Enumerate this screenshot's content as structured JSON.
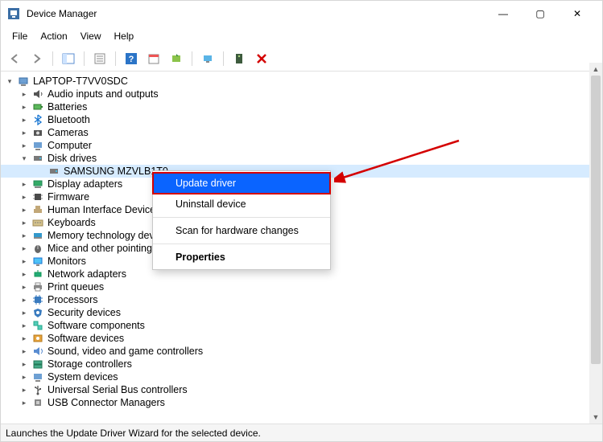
{
  "window": {
    "title": "Device Manager",
    "minimize_glyph": "—",
    "maximize_glyph": "▢",
    "close_glyph": "✕"
  },
  "menu": {
    "file": "File",
    "action": "Action",
    "view": "View",
    "help": "Help"
  },
  "tree": {
    "root": "LAPTOP-T7VV0SDC",
    "disk_category": "Disk drives",
    "disk_child": "SAMSUNG MZVLB1T0",
    "categories": {
      "audio": "Audio inputs and outputs",
      "batteries": "Batteries",
      "bluetooth": "Bluetooth",
      "cameras": "Cameras",
      "computer": "Computer",
      "display": "Display adapters",
      "firmware": "Firmware",
      "hid": "Human Interface Devices",
      "keyboards": "Keyboards",
      "memtech": "Memory technology devices",
      "mice": "Mice and other pointing devices",
      "monitors": "Monitors",
      "network": "Network adapters",
      "printq": "Print queues",
      "proc": "Processors",
      "sec": "Security devices",
      "swcomp": "Software components",
      "swdev": "Software devices",
      "sound": "Sound, video and game controllers",
      "storage": "Storage controllers",
      "sysdev": "System devices",
      "usb": "Universal Serial Bus controllers",
      "usbmgr": "USB Connector Managers"
    }
  },
  "ctx": {
    "update": "Update driver",
    "uninstall": "Uninstall device",
    "scan": "Scan for hardware changes",
    "props": "Properties"
  },
  "status": {
    "text": "Launches the Update Driver Wizard for the selected device."
  }
}
